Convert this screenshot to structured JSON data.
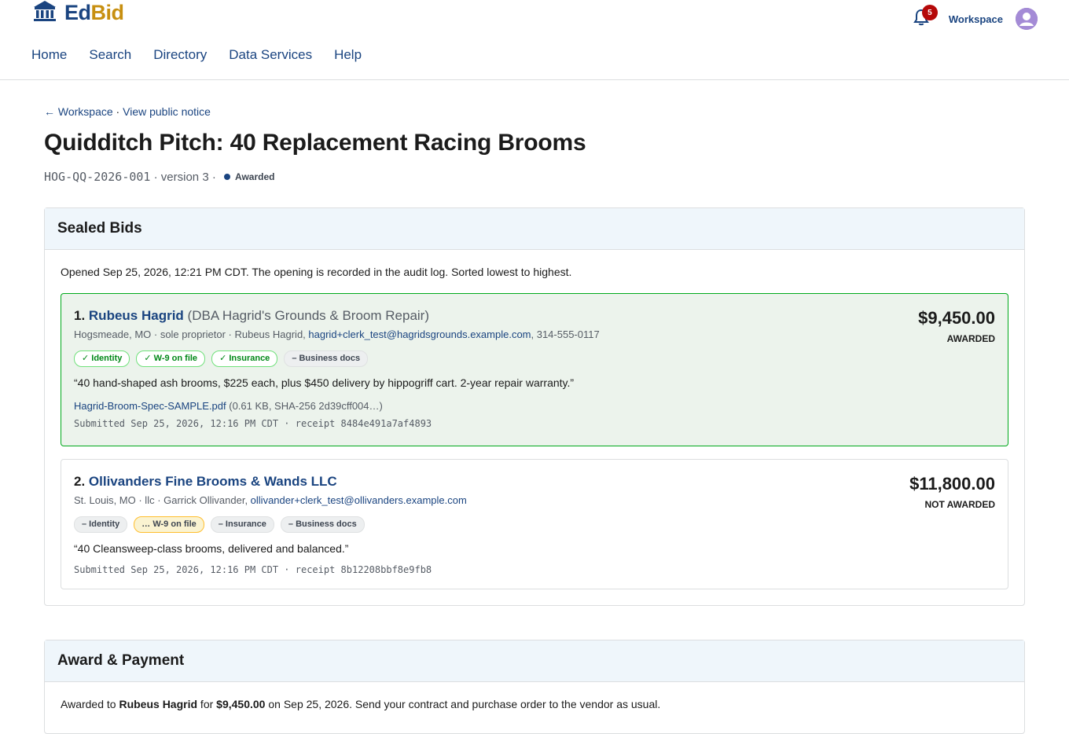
{
  "app": {
    "logo_ed": "Ed",
    "logo_bid": "Bid"
  },
  "nav": [
    "Home",
    "Search",
    "Directory",
    "Data Services",
    "Help"
  ],
  "header": {
    "notifications": "5",
    "workspace": "Workspace"
  },
  "breadcrumb": {
    "back": "← Workspace",
    "sep": " · ",
    "public": "View public notice"
  },
  "page": {
    "title": "Quidditch Pitch: 40 Replacement Racing Brooms",
    "solicitation_id": "HOG-QQ-2026-001",
    "version": " · version 3 · ",
    "status": "Awarded"
  },
  "sealed_bids": {
    "heading": "Sealed Bids",
    "intro": "Opened Sep 25, 2026, 12:21 PM CDT. The opening is recorded in the audit log. Sorted lowest to highest.",
    "bids": [
      {
        "rank": "1. ",
        "name": "Rubeus Hagrid",
        "dba": " (DBA Hagrid's Grounds & Broom Repair)",
        "meta": "Hogsmeade, MO · sole proprietor · Rubeus Hagrid, ",
        "email": "hagrid+clerk_test@hagridsgrounds.example.com",
        "phone": ", 314-555-0117",
        "chips": [
          "✓ Identity",
          "✓ W-9 on file",
          "✓ Insurance",
          "– Business docs"
        ],
        "quote": "“40 hand-shaped ash brooms, $225 each, plus $450 delivery by hippogriff cart. 2-year repair warranty.”",
        "attachment": "Hagrid-Broom-Spec-SAMPLE.pdf",
        "attachment_meta": " (0.61 KB, SHA-256 2d39cff004…)",
        "submitted": "Submitted Sep 25, 2026, 12:16 PM CDT · receipt 8484e491a7af4893",
        "amount": "$9,450.00",
        "result": "AWARDED"
      },
      {
        "rank": "2. ",
        "name": "Ollivanders Fine Brooms & Wands LLC",
        "meta": "St. Louis, MO · llc · Garrick Ollivander, ",
        "email": "ollivander+clerk_test@ollivanders.example.com",
        "chips": [
          "– Identity",
          "… W-9 on file",
          "– Insurance",
          "– Business docs"
        ],
        "quote": "“40 Cleansweep-class brooms, delivered and balanced.”",
        "submitted": "Submitted Sep 25, 2026, 12:16 PM CDT · receipt 8b12208bbf8e9fb8",
        "amount": "$11,800.00",
        "result": "NOT AWARDED"
      }
    ]
  },
  "award": {
    "heading": "Award & Payment",
    "t1": "Awarded to ",
    "vendor": "Rubeus Hagrid",
    "t2": " for ",
    "amount": "$9,450.00",
    "t3": " on Sep 25, 2026. Send your contract and purchase order to the vendor as usual."
  },
  "colors": {
    "primary": "#1a4480",
    "accent": "#c78f10",
    "success": "#00a91c",
    "badge": "#b50909"
  },
  "icons": {
    "logo": "institution-icon",
    "bell": "bell-icon",
    "avatar": "user-avatar-icon"
  }
}
